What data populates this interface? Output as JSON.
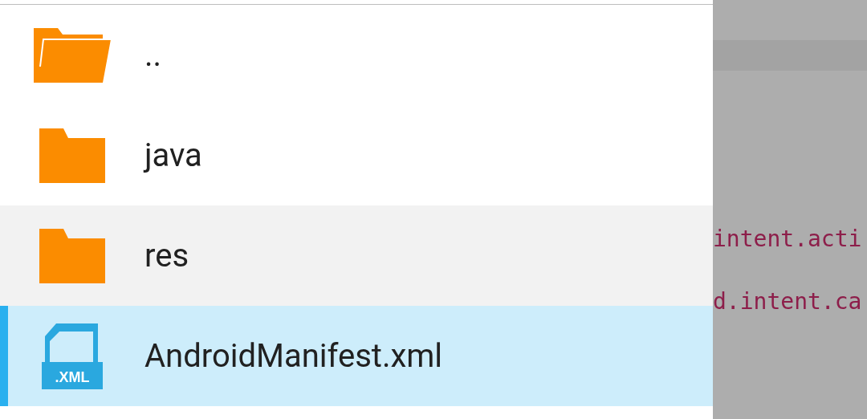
{
  "file_list": [
    {
      "kind": "parent",
      "name": "..",
      "selected": false,
      "highlighted": false
    },
    {
      "kind": "folder",
      "name": "java",
      "selected": false,
      "highlighted": false
    },
    {
      "kind": "folder",
      "name": "res",
      "selected": false,
      "highlighted": true
    },
    {
      "kind": "xml",
      "name": "AndroidManifest.xml",
      "selected": true,
      "highlighted": false,
      "badge": ".XML"
    }
  ],
  "background_code": [
    "intent.acti",
    "d.intent.ca"
  ]
}
